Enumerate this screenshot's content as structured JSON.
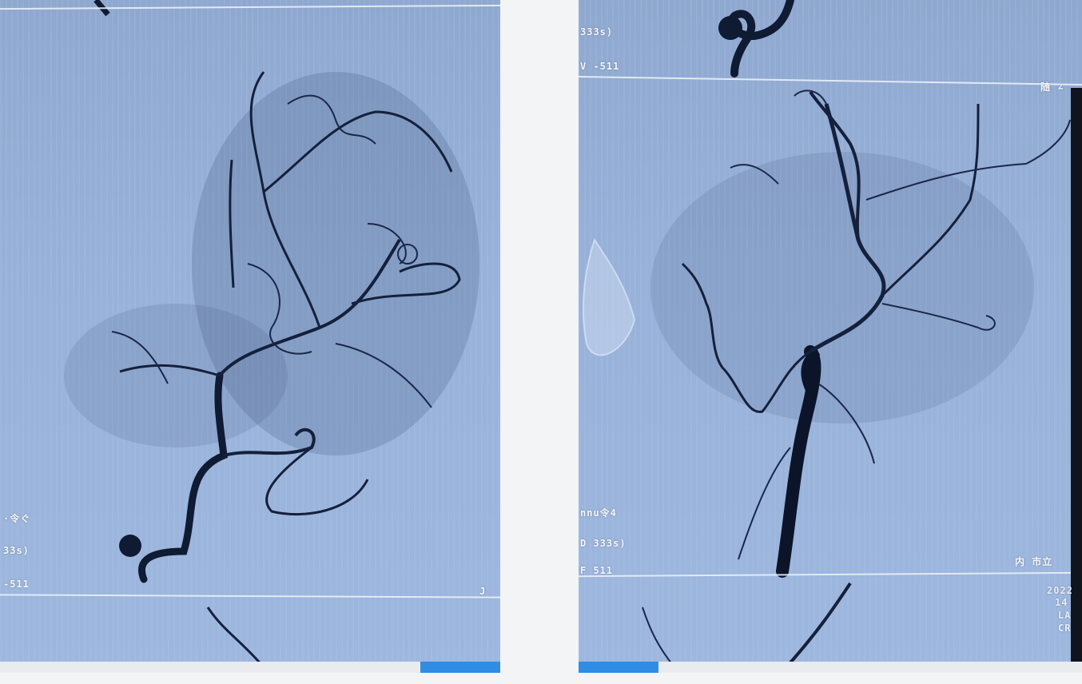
{
  "left_panel": {
    "overlay": {
      "mid_label": "·令ぐ",
      "time_label": "33s)",
      "code_label": "-511",
      "corner_label": "J"
    }
  },
  "right_panel": {
    "overlay": {
      "top_time_label": "333s)",
      "top_code_label": "V -511",
      "top_corner_label": "随 ∠",
      "mid_label": "nnu令4",
      "time_label": "D 333s)",
      "code_label": "F 511",
      "right_label": "内 市立",
      "info_date": "2022",
      "info_num": "14",
      "info_lao": "LA",
      "info_cr": "CR"
    }
  },
  "colors": {
    "background_blue": "#97b1d9",
    "vessel": "#0f1a33",
    "accent_tab": "#2f8de4"
  }
}
